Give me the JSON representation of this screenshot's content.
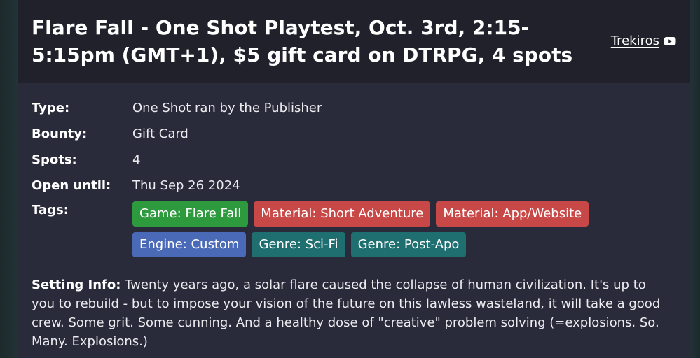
{
  "header": {
    "title": "Flare Fall - One Shot Playtest, Oct. 3rd, 2:15-5:15pm (GMT+1), $5 gift card on DTRPG, 4 spots",
    "author": "Trekiros",
    "author_icon": "youtube-icon"
  },
  "details": {
    "type_label": "Type:",
    "type_value": "One Shot ran by the Publisher",
    "bounty_label": "Bounty:",
    "bounty_value": "Gift Card",
    "spots_label": "Spots:",
    "spots_value": "4",
    "open_label": "Open until:",
    "open_value": "Thu Sep 26 2024",
    "tags_label": "Tags:"
  },
  "tags": [
    {
      "label": "Game: Flare Fall",
      "color": "#2e9a3e"
    },
    {
      "label": "Material: Short Adventure",
      "color": "#c84848"
    },
    {
      "label": "Material: App/Website",
      "color": "#c84848"
    },
    {
      "label": "Engine: Custom",
      "color": "#4a6ab8"
    },
    {
      "label": "Genre: Sci-Fi",
      "color": "#1f6e70"
    },
    {
      "label": "Genre: Post-Apo",
      "color": "#1f6e70"
    }
  ],
  "setting": {
    "label": "Setting Info:",
    "text": " Twenty years ago, a solar flare caused the collapse of human civilization. It's up to you to rebuild - but to impose your vision of the future on this lawless wasteland, it will take a good crew. Some grit. Some cunning. And a healthy dose of \"creative\" problem solving (=explosions. So. Many. Explosions.)"
  },
  "colors": {
    "page_bg": "#223236",
    "card_bg": "#2a2b3a",
    "header_bg": "#20212b"
  }
}
